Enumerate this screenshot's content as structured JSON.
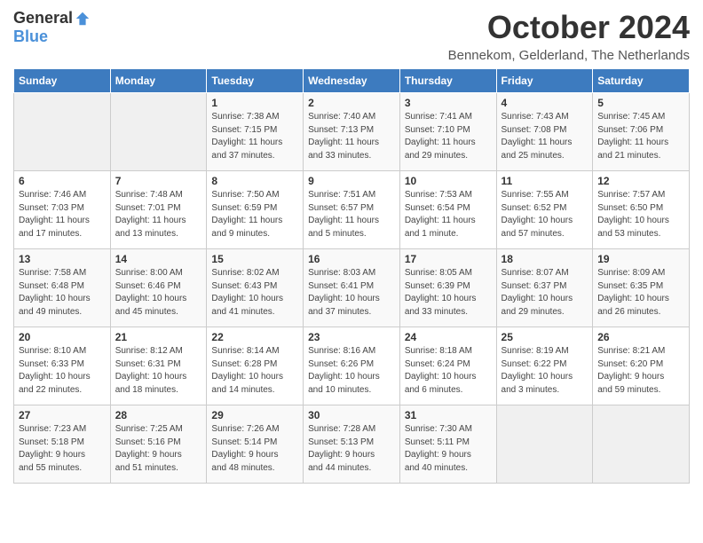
{
  "logo": {
    "general": "General",
    "blue": "Blue"
  },
  "title": "October 2024",
  "subtitle": "Bennekom, Gelderland, The Netherlands",
  "weekdays": [
    "Sunday",
    "Monday",
    "Tuesday",
    "Wednesday",
    "Thursday",
    "Friday",
    "Saturday"
  ],
  "weeks": [
    [
      {
        "day": "",
        "info": ""
      },
      {
        "day": "",
        "info": ""
      },
      {
        "day": "1",
        "info": "Sunrise: 7:38 AM\nSunset: 7:15 PM\nDaylight: 11 hours\nand 37 minutes."
      },
      {
        "day": "2",
        "info": "Sunrise: 7:40 AM\nSunset: 7:13 PM\nDaylight: 11 hours\nand 33 minutes."
      },
      {
        "day": "3",
        "info": "Sunrise: 7:41 AM\nSunset: 7:10 PM\nDaylight: 11 hours\nand 29 minutes."
      },
      {
        "day": "4",
        "info": "Sunrise: 7:43 AM\nSunset: 7:08 PM\nDaylight: 11 hours\nand 25 minutes."
      },
      {
        "day": "5",
        "info": "Sunrise: 7:45 AM\nSunset: 7:06 PM\nDaylight: 11 hours\nand 21 minutes."
      }
    ],
    [
      {
        "day": "6",
        "info": "Sunrise: 7:46 AM\nSunset: 7:03 PM\nDaylight: 11 hours\nand 17 minutes."
      },
      {
        "day": "7",
        "info": "Sunrise: 7:48 AM\nSunset: 7:01 PM\nDaylight: 11 hours\nand 13 minutes."
      },
      {
        "day": "8",
        "info": "Sunrise: 7:50 AM\nSunset: 6:59 PM\nDaylight: 11 hours\nand 9 minutes."
      },
      {
        "day": "9",
        "info": "Sunrise: 7:51 AM\nSunset: 6:57 PM\nDaylight: 11 hours\nand 5 minutes."
      },
      {
        "day": "10",
        "info": "Sunrise: 7:53 AM\nSunset: 6:54 PM\nDaylight: 11 hours\nand 1 minute."
      },
      {
        "day": "11",
        "info": "Sunrise: 7:55 AM\nSunset: 6:52 PM\nDaylight: 10 hours\nand 57 minutes."
      },
      {
        "day": "12",
        "info": "Sunrise: 7:57 AM\nSunset: 6:50 PM\nDaylight: 10 hours\nand 53 minutes."
      }
    ],
    [
      {
        "day": "13",
        "info": "Sunrise: 7:58 AM\nSunset: 6:48 PM\nDaylight: 10 hours\nand 49 minutes."
      },
      {
        "day": "14",
        "info": "Sunrise: 8:00 AM\nSunset: 6:46 PM\nDaylight: 10 hours\nand 45 minutes."
      },
      {
        "day": "15",
        "info": "Sunrise: 8:02 AM\nSunset: 6:43 PM\nDaylight: 10 hours\nand 41 minutes."
      },
      {
        "day": "16",
        "info": "Sunrise: 8:03 AM\nSunset: 6:41 PM\nDaylight: 10 hours\nand 37 minutes."
      },
      {
        "day": "17",
        "info": "Sunrise: 8:05 AM\nSunset: 6:39 PM\nDaylight: 10 hours\nand 33 minutes."
      },
      {
        "day": "18",
        "info": "Sunrise: 8:07 AM\nSunset: 6:37 PM\nDaylight: 10 hours\nand 29 minutes."
      },
      {
        "day": "19",
        "info": "Sunrise: 8:09 AM\nSunset: 6:35 PM\nDaylight: 10 hours\nand 26 minutes."
      }
    ],
    [
      {
        "day": "20",
        "info": "Sunrise: 8:10 AM\nSunset: 6:33 PM\nDaylight: 10 hours\nand 22 minutes."
      },
      {
        "day": "21",
        "info": "Sunrise: 8:12 AM\nSunset: 6:31 PM\nDaylight: 10 hours\nand 18 minutes."
      },
      {
        "day": "22",
        "info": "Sunrise: 8:14 AM\nSunset: 6:28 PM\nDaylight: 10 hours\nand 14 minutes."
      },
      {
        "day": "23",
        "info": "Sunrise: 8:16 AM\nSunset: 6:26 PM\nDaylight: 10 hours\nand 10 minutes."
      },
      {
        "day": "24",
        "info": "Sunrise: 8:18 AM\nSunset: 6:24 PM\nDaylight: 10 hours\nand 6 minutes."
      },
      {
        "day": "25",
        "info": "Sunrise: 8:19 AM\nSunset: 6:22 PM\nDaylight: 10 hours\nand 3 minutes."
      },
      {
        "day": "26",
        "info": "Sunrise: 8:21 AM\nSunset: 6:20 PM\nDaylight: 9 hours\nand 59 minutes."
      }
    ],
    [
      {
        "day": "27",
        "info": "Sunrise: 7:23 AM\nSunset: 5:18 PM\nDaylight: 9 hours\nand 55 minutes."
      },
      {
        "day": "28",
        "info": "Sunrise: 7:25 AM\nSunset: 5:16 PM\nDaylight: 9 hours\nand 51 minutes."
      },
      {
        "day": "29",
        "info": "Sunrise: 7:26 AM\nSunset: 5:14 PM\nDaylight: 9 hours\nand 48 minutes."
      },
      {
        "day": "30",
        "info": "Sunrise: 7:28 AM\nSunset: 5:13 PM\nDaylight: 9 hours\nand 44 minutes."
      },
      {
        "day": "31",
        "info": "Sunrise: 7:30 AM\nSunset: 5:11 PM\nDaylight: 9 hours\nand 40 minutes."
      },
      {
        "day": "",
        "info": ""
      },
      {
        "day": "",
        "info": ""
      }
    ]
  ]
}
